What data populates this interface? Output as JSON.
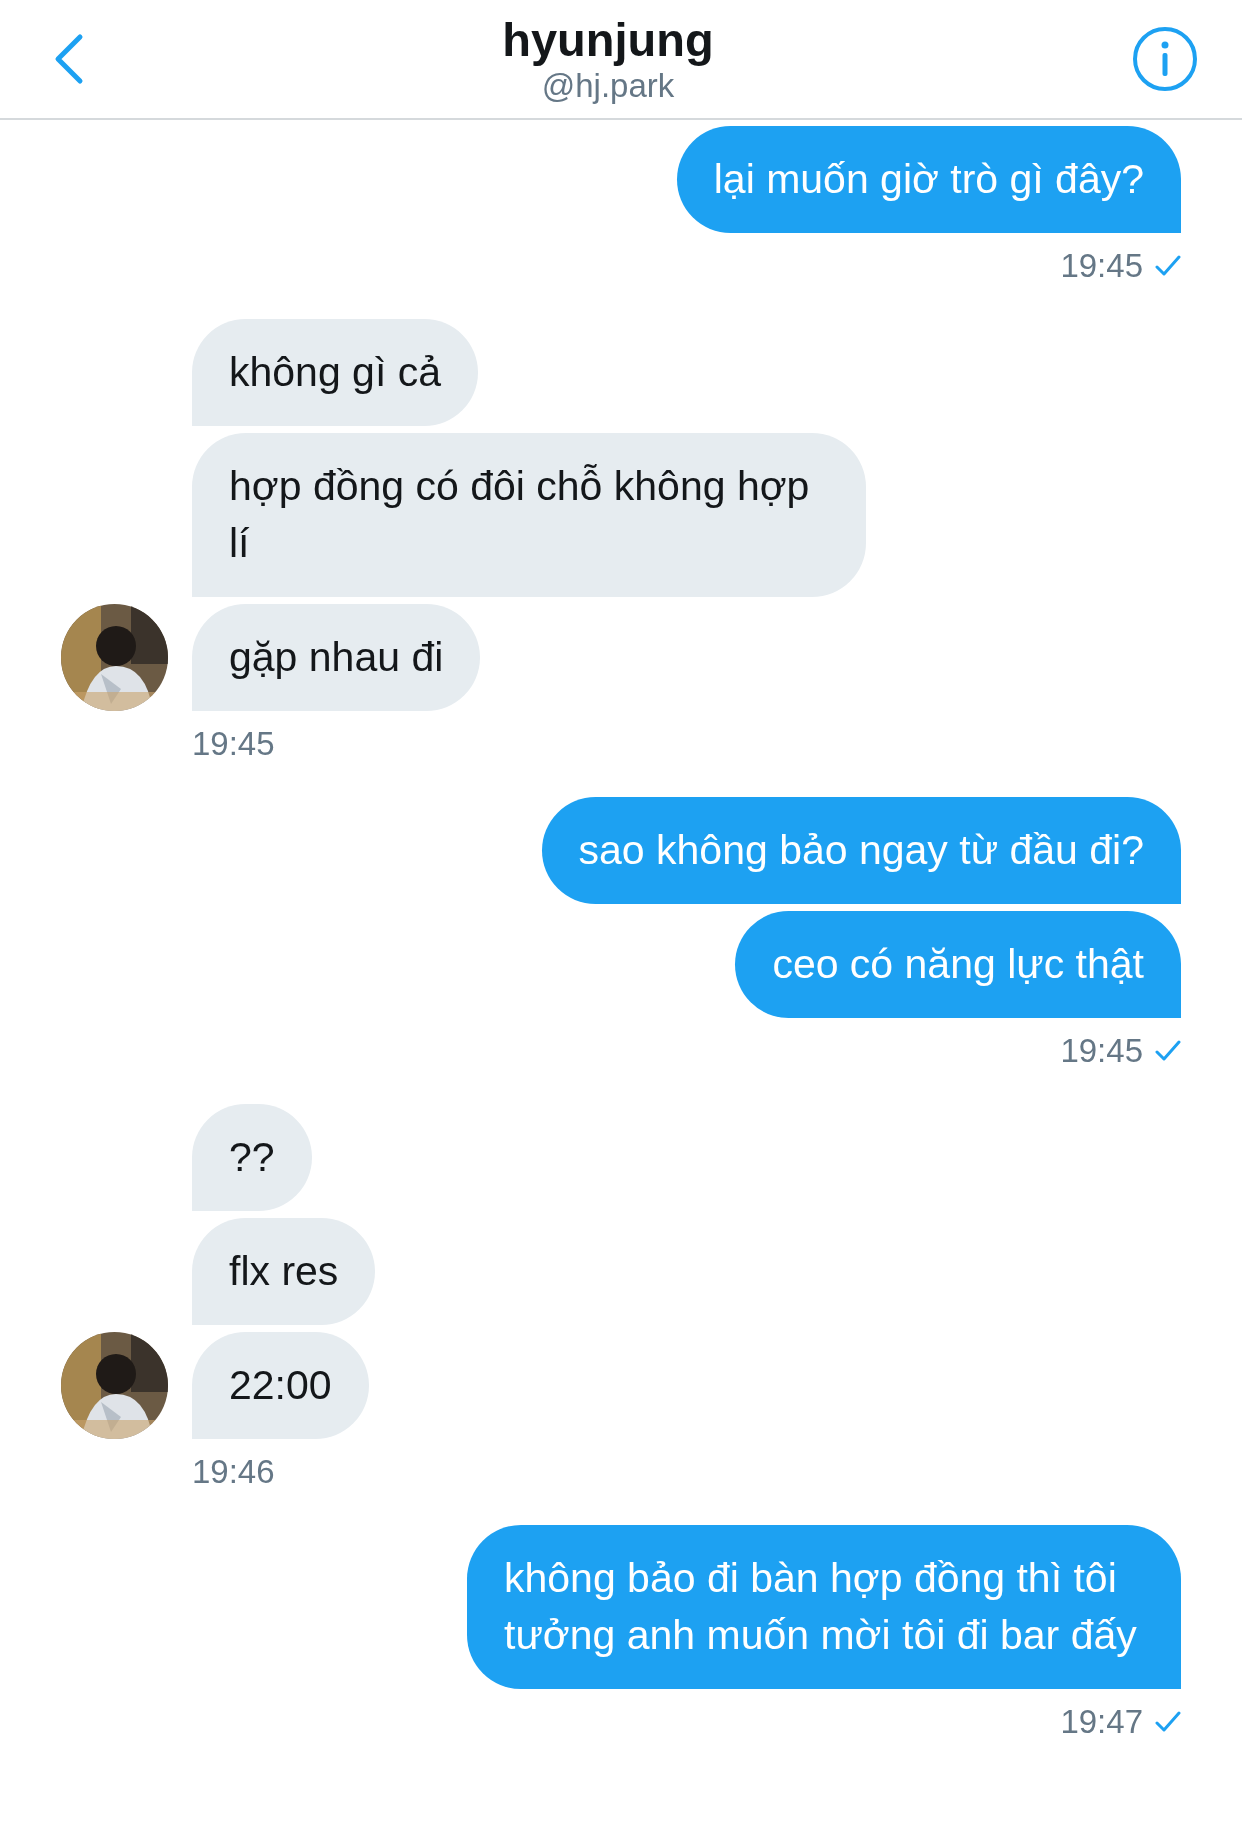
{
  "header": {
    "name": "hyunjung",
    "handle": "@hj.park"
  },
  "groups": [
    {
      "kind": "sent",
      "messages": [
        "lại muốn giờ trò gì đây?"
      ],
      "time": "19:45",
      "read": true
    },
    {
      "kind": "received",
      "messages": [
        "không gì cả",
        "hợp đồng có đôi chỗ không hợp lí",
        "gặp nhau đi"
      ],
      "time": "19:45"
    },
    {
      "kind": "sent",
      "messages": [
        "sao không bảo ngay từ đầu đi?",
        "ceo có năng lực thật"
      ],
      "time": "19:45",
      "read": true
    },
    {
      "kind": "received",
      "messages": [
        "??",
        "flx res",
        "22:00"
      ],
      "time": "19:46"
    },
    {
      "kind": "sent",
      "messages": [
        "không bảo đi bàn hợp đồng thì tôi tưởng anh muốn mời tôi đi bar đấy"
      ],
      "time": "19:47",
      "read": true
    }
  ]
}
